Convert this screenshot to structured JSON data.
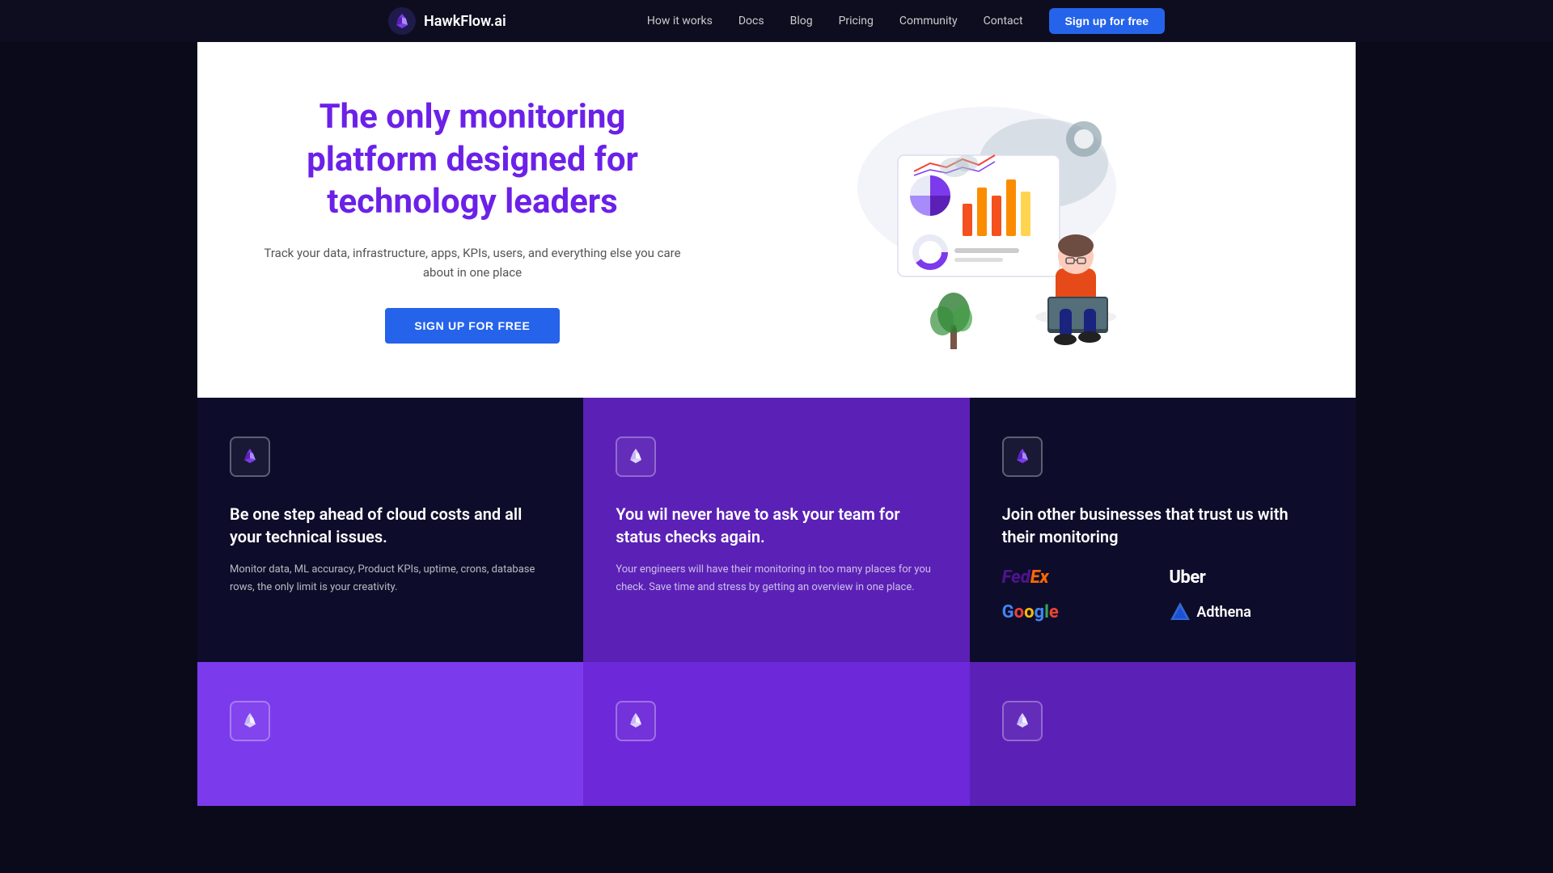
{
  "nav": {
    "logo_text": "HawkFlow.ai",
    "links": [
      {
        "label": "How it works",
        "href": "#"
      },
      {
        "label": "Docs",
        "href": "#"
      },
      {
        "label": "Blog",
        "href": "#"
      },
      {
        "label": "Pricing",
        "href": "#"
      },
      {
        "label": "Community",
        "href": "#"
      },
      {
        "label": "Contact",
        "href": "#"
      }
    ],
    "cta_label": "Sign up for free"
  },
  "hero": {
    "title": "The only monitoring platform designed for technology leaders",
    "subtitle": "Track your data, infrastructure, apps, KPIs, users, and everything else you care about in one place",
    "cta_label": "SIGN UP FOR FREE"
  },
  "features": [
    {
      "id": "cloud-costs",
      "title": "Be one step ahead of cloud costs and all your technical issues.",
      "desc": "Monitor data, ML accuracy, Product KPIs, uptime, crons, database rows, the only limit is your creativity.",
      "bg": "dark1"
    },
    {
      "id": "status-checks",
      "title": "You wil never have to ask your team for status checks again.",
      "desc": "Your engineers will have their monitoring in too many places for you check. Save time and stress by getting an overview in one place.",
      "bg": "purple1"
    },
    {
      "id": "trusted",
      "title": "Join other businesses that trust us with their monitoring",
      "desc": "",
      "bg": "dark2",
      "logos": [
        {
          "name": "FedEx",
          "style": "fedex"
        },
        {
          "name": "Uber",
          "style": "uber"
        },
        {
          "name": "Google",
          "style": "google"
        },
        {
          "name": "Adthena",
          "style": "adthena"
        }
      ]
    }
  ],
  "features_row2": [
    {
      "bg": "purple2"
    },
    {
      "bg": "purple3"
    },
    {
      "bg": "purple4"
    }
  ],
  "colors": {
    "accent_purple": "#7c3aed",
    "dark_bg": "#0a0a1a",
    "nav_bg": "#0d0d1f"
  }
}
